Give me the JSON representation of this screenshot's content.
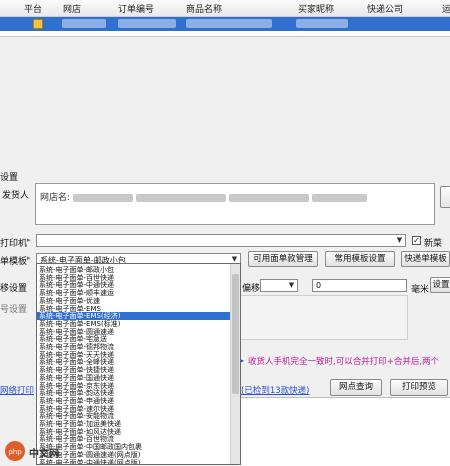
{
  "grid": {
    "headers": [
      "平台",
      "网店",
      "订单编号",
      "商品名称",
      "买家昵称",
      "快递公司",
      "运"
    ]
  },
  "panel": {
    "section_title": "设置",
    "sender_label": "发货人",
    "sender_prefix": "网店名:",
    "printer_label": "打印机",
    "template_label": "单模板",
    "template_selected": "系统-电子面单-邮政小包",
    "btn_available": "可用面单款管理",
    "btn_common": "常用模板设置",
    "btn_quick": "快递单模板",
    "new_label": "新菜",
    "offset_label": "移设置",
    "offset_sub": "偏移",
    "offset_value": "0",
    "unit": "毫米",
    "btn_set": "设置",
    "hint_text": "收货人手机完全一致时,可以合并打印+合并后,两个",
    "link_left": "网络打印",
    "link_detected": "(已检到13款快递)",
    "btn_query": "网点查询",
    "btn_preview": "打印预览",
    "side_label": "号设置"
  },
  "dropdown": {
    "items": [
      "系统-电子面单-邮政小包",
      "系统-电子面单-百世快递",
      "系统-电子面单-中通快递",
      "系统-电子面单-顺丰速运",
      "系统-电子面单-优速",
      "系统-电子面单-EMS",
      "系统-电子面单-EMS(经济)",
      "系统-电子面单-EMS(标准)",
      "系统-电子面单-圆通速递",
      "系统-电子面单-宅急送",
      "系统-电子面单-德邦物流",
      "系统-电子面单-天天快递",
      "系统-电子面单-全峰快递",
      "系统-电子面单-快捷快递",
      "系统-电子面单-国通快递",
      "系统-电子面单-京东快递",
      "系统-电子面单-韵达快递",
      "系统-电子面单-申通快递",
      "系统-电子面单-速尔快递",
      "系统-电子面单-安能物流",
      "系统-电子面单-加运美快递",
      "系统-电子面单-如风达快递",
      "系统-电子面单-百世物流",
      "系统-电子面单-中国邮政国内包裹",
      "系统-电子面单-圆通速递(网点版)",
      "系统-电子面单-中通快递(网点版)"
    ],
    "selected_index": 6
  },
  "watermark": {
    "text": "中文网"
  }
}
